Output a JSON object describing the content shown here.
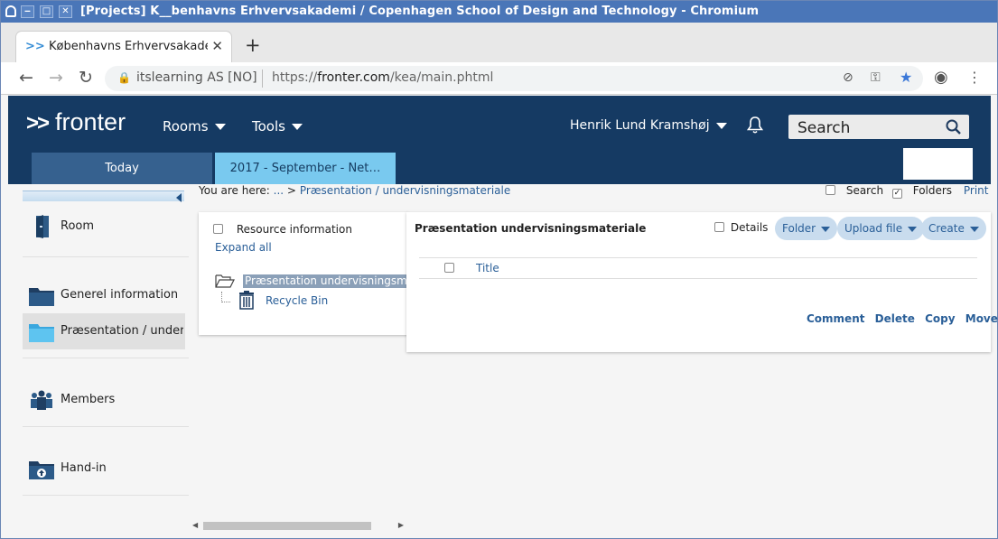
{
  "window": {
    "title": "[Projects] K__benhavns Erhvervsakademi / Copenhagen School of Design and Technology - Chromium",
    "controls": [
      "‒",
      "□",
      "✕"
    ]
  },
  "browser": {
    "tab_title": "Københavns Erhvervsakademi",
    "site_info": "itslearning AS [NO]",
    "url_prefix": "https://",
    "url_host": "fronter.com",
    "url_path": "/kea/main.phtml"
  },
  "header": {
    "logo": "fronter",
    "menu": [
      {
        "label": "Rooms"
      },
      {
        "label": "Tools"
      }
    ],
    "user": "Henrik Lund Kramshøj",
    "search_placeholder": "Search",
    "tabs": [
      {
        "label": "Today"
      },
      {
        "label": "2017 - September - Net…"
      }
    ]
  },
  "sidebar": {
    "items": [
      {
        "label": "Room",
        "icon": "room-door-icon"
      },
      {
        "label": "Generel information",
        "icon": "folder-icon"
      },
      {
        "label": "Præsentation / under…",
        "icon": "folder-open-icon",
        "selected": true
      },
      {
        "label": "Members",
        "icon": "members-icon"
      },
      {
        "label": "Hand-in",
        "icon": "hand-in-folder-icon"
      }
    ]
  },
  "breadcrumb": {
    "prefix": "You are here:",
    "ellipsis": "...",
    "separator": ">",
    "current": "Præsentation / undervisningsmateriale"
  },
  "top_options": {
    "search_label": "Search",
    "folders_label": "Folders",
    "print_label": "Print",
    "folders_checked": true
  },
  "tree": {
    "resource_info": "Resource information",
    "expand_all": "Expand all",
    "root": "Præsentation undervisningsmateriale",
    "children": [
      "Recycle Bin"
    ]
  },
  "main": {
    "title": "Præsentation undervisningsmateriale",
    "details_label": "Details",
    "buttons": [
      "Folder",
      "Upload file",
      "Create"
    ],
    "column_title": "Title",
    "actions": [
      "Comment",
      "Delete",
      "Copy",
      "Move"
    ]
  },
  "colors": {
    "header_bg": "#153a63",
    "today_tab": "#36618f",
    "active_tab": "#79c9ef",
    "link": "#2a5f98",
    "pill_bg": "#c9dcee"
  }
}
